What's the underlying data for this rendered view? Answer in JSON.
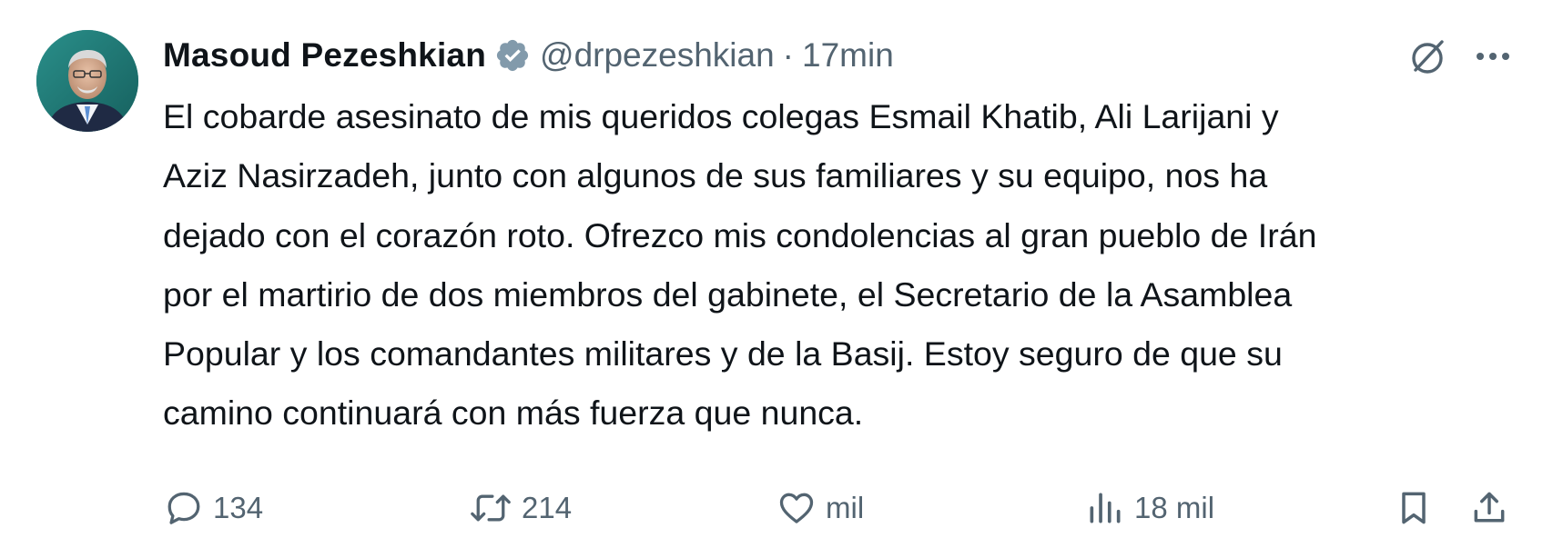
{
  "tweet": {
    "author": {
      "display_name": "Masoud Pezeshkian",
      "handle": "@drpezeshkian",
      "verified": true,
      "avatar_icon": "profile-photo"
    },
    "separator": "·",
    "time": "17min",
    "text_lines": [
      "El cobarde asesinato de mis queridos colegas Esmail Khatib, Ali Larijani y",
      "Aziz Nasirzadeh, junto con algunos de sus familiares y su equipo, nos ha",
      "dejado con el corazón roto. Ofrezco mis condolencias al gran pueblo de Irán",
      "por el martirio de dos miembros del gabinete, el Secretario de la Asamblea",
      "Popular y los comandantes militares y de la Basij. Estoy seguro de que su",
      "camino continuará con más fuerza que nunca."
    ],
    "actions": {
      "replies": "134",
      "reposts": "214",
      "likes": "mil",
      "views": "18 mil"
    },
    "icons": {
      "reply": "reply-icon",
      "repost": "repost-icon",
      "like": "heart-icon",
      "views": "views-icon",
      "bookmark": "bookmark-icon",
      "share": "share-icon",
      "grok": "grok-icon",
      "more": "more-icon",
      "verified": "verified-badge-icon"
    },
    "colors": {
      "text": "#0f1419",
      "secondary": "#536471",
      "verified_badge": "#829aab"
    }
  }
}
